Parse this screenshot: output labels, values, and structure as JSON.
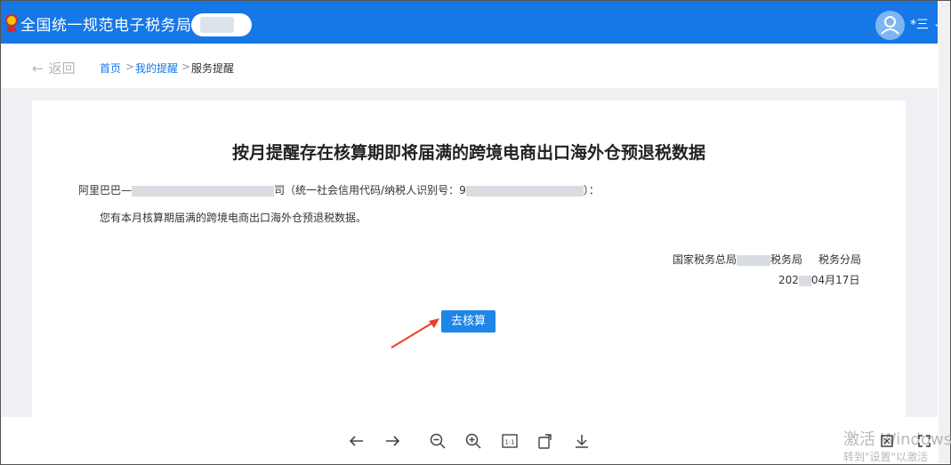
{
  "header": {
    "app_title": "全国统一规范电子税务局",
    "user_name": "*三",
    "brand_color": "#1677e6"
  },
  "breadcrumb": {
    "back_label": "返回",
    "items": [
      "首页",
      "我的提醒",
      "服务提醒"
    ],
    "separator": ">"
  },
  "notice": {
    "title": "按月提醒存在核算期即将届满的跨境电商出口海外仓预退税数据",
    "company_prefix": "阿里巴巴—",
    "company_suffix": "司",
    "credit_code_label": "（统一社会信用代码/纳税人识别号：",
    "credit_code_prefix": "9",
    "credit_code_end": "）：",
    "message": "您有本月核算期届满的跨境电商出口海外仓预退税数据。",
    "sign_org_a": "国家税务总局",
    "sign_org_b": "税务局",
    "sign_org_c": "税务分局",
    "sign_date_a": "202",
    "sign_date_b": "04月17日",
    "action_label": "去核算"
  },
  "viewer_toolbar": {
    "icons": [
      "arrow-left-icon",
      "arrow-right-icon",
      "zoom-out-icon",
      "zoom-in-icon",
      "actual-size-icon",
      "rotate-icon",
      "download-icon"
    ],
    "actual_size_label": "1:1"
  },
  "watermark": {
    "line1": "激活 Windows",
    "line2": "转到\"设置\"以激活"
  }
}
